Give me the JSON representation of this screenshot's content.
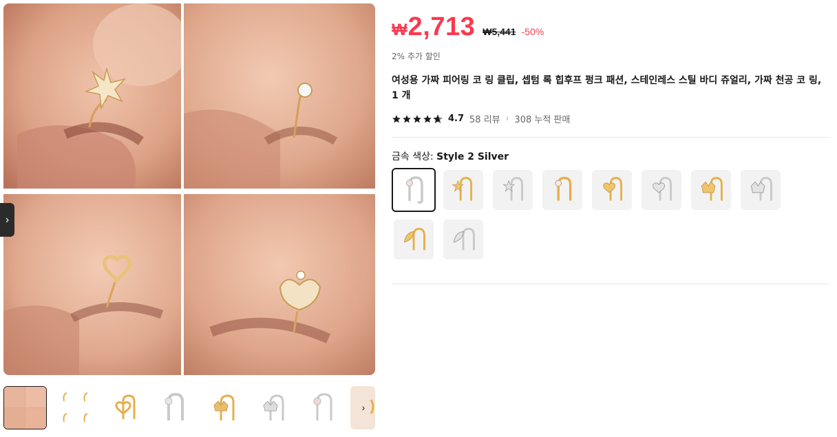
{
  "product": {
    "currency_symbol": "₩",
    "price": "2,713",
    "original_price": "₩5,441",
    "discount": "-50%",
    "extra_discount": "2% 추가 할인",
    "title": "여성용 가짜 피어링 코 링 클립, 셉텀 록 힙후프 펑크 패션, 스테인레스 스틸 바디 쥬얼리, 가짜 천공 코 링, 1 개"
  },
  "rating": {
    "stars": 4.7,
    "value": "4.7",
    "reviews": "58 리뷰",
    "separator": "ı",
    "sold": "308 누적 판매"
  },
  "variant": {
    "label": "금속 색상: ",
    "selected": "Style 2 Silver",
    "options": [
      {
        "icon": "silver-gem-ring-icon",
        "color": "#c9c9c9",
        "selected": true
      },
      {
        "icon": "gold-star-ring-icon",
        "color": "#e5b04a",
        "selected": false
      },
      {
        "icon": "silver-star-ring-icon",
        "color": "#c9c9c9",
        "selected": false
      },
      {
        "icon": "gold-gem-ring-icon",
        "color": "#e5b04a",
        "selected": false
      },
      {
        "icon": "gold-heart-ring-icon",
        "color": "#e5b04a",
        "selected": false
      },
      {
        "icon": "silver-heart-ring-icon",
        "color": "#c9c9c9",
        "selected": false
      },
      {
        "icon": "gold-crown-ring-icon",
        "color": "#e5b04a",
        "selected": false
      },
      {
        "icon": "silver-crown-ring-icon",
        "color": "#c9c9c9",
        "selected": false
      },
      {
        "icon": "gold-leaf-ring-icon",
        "color": "#e5b04a",
        "selected": false
      },
      {
        "icon": "silver-leaf-ring-icon",
        "color": "#c9c9c9",
        "selected": false
      }
    ]
  },
  "gallery": {
    "main_image": "nose-ring-collage-image",
    "prev_icon": "chevron-left-icon",
    "next_icon": "chevron-right-icon",
    "next_glyph": "›",
    "prev_glyph": "›",
    "thumbnails": [
      {
        "name": "collage-thumbnail",
        "active": true
      },
      {
        "name": "four-rings-thumbnail",
        "active": false
      },
      {
        "name": "gold-heart-thumbnail",
        "active": false
      },
      {
        "name": "silver-ring-thumbnail",
        "active": false
      },
      {
        "name": "gold-crown-thumbnail",
        "active": false
      },
      {
        "name": "silver-crown-thumbnail",
        "active": false
      },
      {
        "name": "silver-gem-thumbnail",
        "active": false
      },
      {
        "name": "partial-thumbnail",
        "active": false
      }
    ]
  },
  "colors": {
    "accent": "#fd384f",
    "text": "#191919",
    "muted": "#666666",
    "swatch_bg": "#f2f2f2",
    "gold": "#e5b04a",
    "silver": "#c9c9c9",
    "skin": "#d9a087"
  }
}
